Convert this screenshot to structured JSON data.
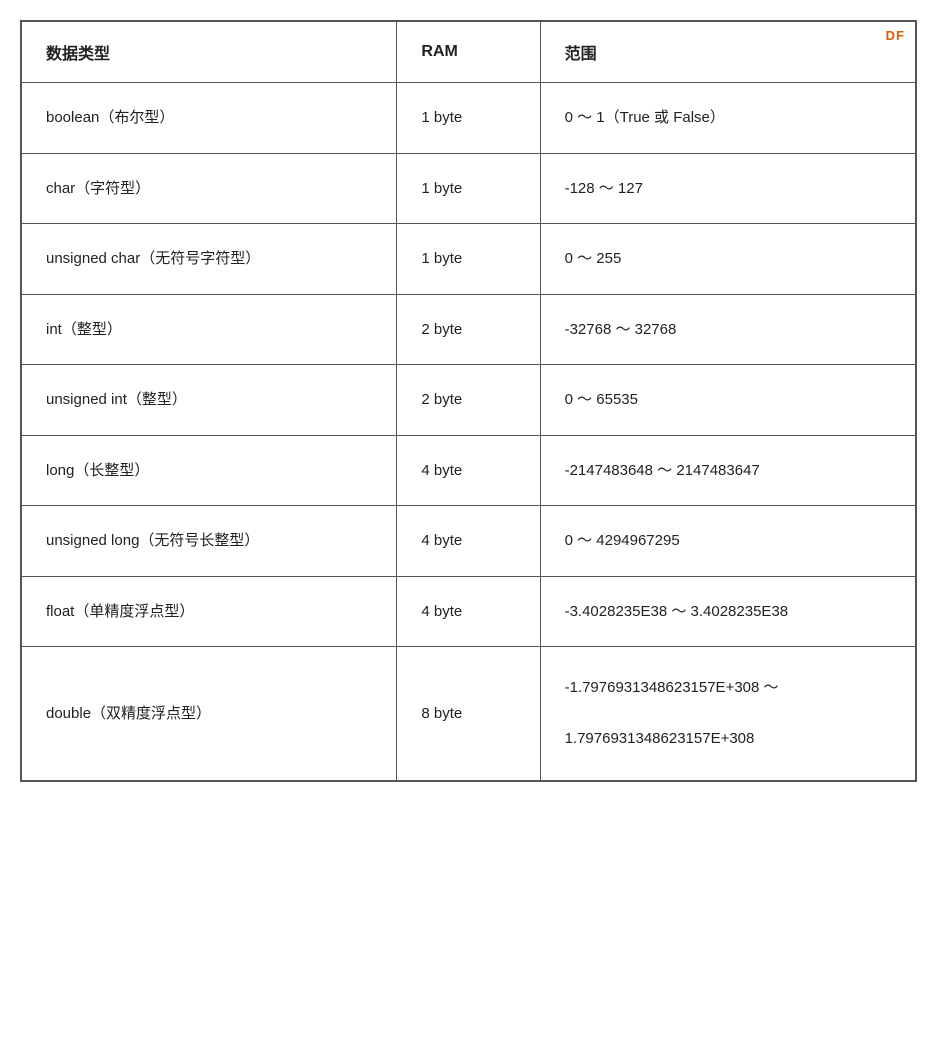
{
  "watermark": "DF",
  "table": {
    "headers": {
      "type": "数据类型",
      "ram": "RAM",
      "range": "范围"
    },
    "rows": [
      {
        "type": "boolean（布尔型）",
        "ram": "1 byte",
        "range": "0 ～ 1（True 或 False）"
      },
      {
        "type": "char（字符型）",
        "ram": "1 byte",
        "range": "-128 ～ 127"
      },
      {
        "type": "unsigned char（无符号字符型）",
        "ram": "1 byte",
        "range": "0 ～ 255"
      },
      {
        "type": "int（整型）",
        "ram": "2 byte",
        "range": "-32768 ～ 32768"
      },
      {
        "type": "unsigned int（整型）",
        "ram": "2 byte",
        "range": "0 ～ 65535"
      },
      {
        "type": "long（长整型）",
        "ram": "4 byte",
        "range": "-2147483648 ～ 2147483647"
      },
      {
        "type": "unsigned long（无符号长整型）",
        "ram": "4 byte",
        "range": "0 ～ 4294967295"
      },
      {
        "type": "float（单精度浮点型）",
        "ram": "4 byte",
        "range": "-3.4028235E38 ～ 3.4028235E38"
      },
      {
        "type": "double（双精度浮点型）",
        "ram": "8 byte",
        "range_line1": "-1.7976931348623157E+308  ～",
        "range_line2": "1.7976931348623157E+308"
      }
    ]
  }
}
